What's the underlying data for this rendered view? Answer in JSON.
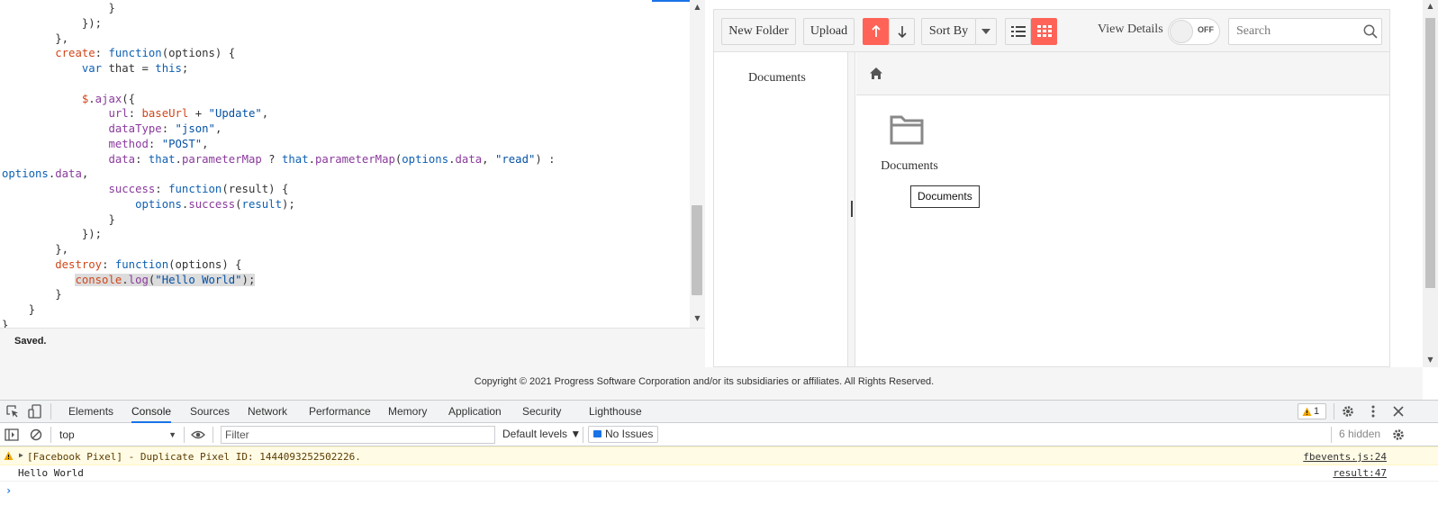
{
  "editor": {
    "lines": [
      [
        {
          "t": "                }",
          "c": "plain"
        }
      ],
      [
        {
          "t": "            });",
          "c": "plain"
        }
      ],
      [
        {
          "t": "        },",
          "c": "plain"
        }
      ],
      [
        {
          "t": "        ",
          "c": "plain"
        },
        {
          "t": "create",
          "c": "var"
        },
        {
          "t": ": ",
          "c": "plain"
        },
        {
          "t": "function",
          "c": "kw"
        },
        {
          "t": "(options) {",
          "c": "plain"
        }
      ],
      [
        {
          "t": "            ",
          "c": "plain"
        },
        {
          "t": "var",
          "c": "kw"
        },
        {
          "t": " that = ",
          "c": "plain"
        },
        {
          "t": "this",
          "c": "kw"
        },
        {
          "t": ";",
          "c": "plain"
        }
      ],
      [
        {
          "t": "",
          "c": "plain"
        }
      ],
      [
        {
          "t": "            ",
          "c": "plain"
        },
        {
          "t": "$",
          "c": "var"
        },
        {
          "t": ".",
          "c": "plain"
        },
        {
          "t": "ajax",
          "c": "prop"
        },
        {
          "t": "({",
          "c": "plain"
        }
      ],
      [
        {
          "t": "                ",
          "c": "plain"
        },
        {
          "t": "url",
          "c": "prop"
        },
        {
          "t": ": ",
          "c": "plain"
        },
        {
          "t": "baseUrl",
          "c": "var"
        },
        {
          "t": " + ",
          "c": "plain"
        },
        {
          "t": "\"Update\"",
          "c": "str"
        },
        {
          "t": ",",
          "c": "plain"
        }
      ],
      [
        {
          "t": "                ",
          "c": "plain"
        },
        {
          "t": "dataType",
          "c": "prop"
        },
        {
          "t": ": ",
          "c": "plain"
        },
        {
          "t": "\"json\"",
          "c": "str"
        },
        {
          "t": ",",
          "c": "plain"
        }
      ],
      [
        {
          "t": "                ",
          "c": "plain"
        },
        {
          "t": "method",
          "c": "prop"
        },
        {
          "t": ": ",
          "c": "plain"
        },
        {
          "t": "\"POST\"",
          "c": "str"
        },
        {
          "t": ",",
          "c": "plain"
        }
      ],
      [
        {
          "t": "                ",
          "c": "plain"
        },
        {
          "t": "data",
          "c": "prop"
        },
        {
          "t": ": ",
          "c": "plain"
        },
        {
          "t": "that",
          "c": "kw"
        },
        {
          "t": ".",
          "c": "plain"
        },
        {
          "t": "parameterMap",
          "c": "prop"
        },
        {
          "t": " ? ",
          "c": "plain"
        },
        {
          "t": "that",
          "c": "kw"
        },
        {
          "t": ".",
          "c": "plain"
        },
        {
          "t": "parameterMap",
          "c": "prop"
        },
        {
          "t": "(",
          "c": "plain"
        },
        {
          "t": "options",
          "c": "kw"
        },
        {
          "t": ".",
          "c": "plain"
        },
        {
          "t": "data",
          "c": "prop"
        },
        {
          "t": ", ",
          "c": "plain"
        },
        {
          "t": "\"read\"",
          "c": "str"
        },
        {
          "t": ") :",
          "c": "plain"
        }
      ],
      [
        {
          "t": "options",
          "c": "kw"
        },
        {
          "t": ".",
          "c": "plain"
        },
        {
          "t": "data",
          "c": "prop"
        },
        {
          "t": ",",
          "c": "plain"
        }
      ],
      [
        {
          "t": "                ",
          "c": "plain"
        },
        {
          "t": "success",
          "c": "prop"
        },
        {
          "t": ": ",
          "c": "plain"
        },
        {
          "t": "function",
          "c": "kw"
        },
        {
          "t": "(result) {",
          "c": "plain"
        }
      ],
      [
        {
          "t": "                    ",
          "c": "plain"
        },
        {
          "t": "options",
          "c": "kw"
        },
        {
          "t": ".",
          "c": "plain"
        },
        {
          "t": "success",
          "c": "prop"
        },
        {
          "t": "(",
          "c": "plain"
        },
        {
          "t": "result",
          "c": "kw"
        },
        {
          "t": ");",
          "c": "plain"
        }
      ],
      [
        {
          "t": "                }",
          "c": "plain"
        }
      ],
      [
        {
          "t": "            });",
          "c": "plain"
        }
      ],
      [
        {
          "t": "        },",
          "c": "plain"
        }
      ],
      [
        {
          "t": "        ",
          "c": "plain"
        },
        {
          "t": "destroy",
          "c": "var"
        },
        {
          "t": ": ",
          "c": "plain"
        },
        {
          "t": "function",
          "c": "kw"
        },
        {
          "t": "(options) {",
          "c": "plain"
        }
      ],
      [
        {
          "t": "           ",
          "c": "plain"
        },
        {
          "t": "console",
          "c": "var",
          "hl": true
        },
        {
          "t": ".",
          "c": "plain",
          "hl": true
        },
        {
          "t": "log",
          "c": "prop",
          "hl": true
        },
        {
          "t": "(",
          "c": "plain",
          "hl": true
        },
        {
          "t": "\"Hello World\"",
          "c": "str",
          "hl": true
        },
        {
          "t": ");",
          "c": "plain",
          "hl": true
        }
      ],
      [
        {
          "t": "        }",
          "c": "plain"
        }
      ],
      [
        {
          "t": "    }",
          "c": "plain"
        }
      ],
      [
        {
          "t": "}",
          "c": "plain"
        }
      ]
    ],
    "status": "Saved."
  },
  "filemanager": {
    "toolbar": {
      "new_folder": "New Folder",
      "upload": "Upload",
      "sort_by": "Sort By",
      "view_details": "View Details",
      "switch_state": "OFF",
      "search_placeholder": "Search"
    },
    "tree": {
      "root": "Documents"
    },
    "items": [
      {
        "name": "Documents",
        "type": "folder"
      }
    ],
    "tooltip": "Documents"
  },
  "footer": {
    "copyright": "Copyright © 2021 Progress Software Corporation and/or its subsidiaries or affiliates. All Rights Reserved."
  },
  "devtools": {
    "tabs": [
      "Elements",
      "Console",
      "Sources",
      "Network",
      "Performance",
      "Memory",
      "Application",
      "Security",
      "Lighthouse"
    ],
    "active_tab": "Console",
    "warning_count": "1",
    "toolbar": {
      "context": "top",
      "filter_placeholder": "Filter",
      "levels": "Default levels ▼",
      "no_issues": "No Issues",
      "hidden": "6 hidden"
    },
    "messages": [
      {
        "level": "warning",
        "text": "[Facebook Pixel] - Duplicate Pixel ID: 1444093252502226.",
        "source": "fbevents.js:24"
      },
      {
        "level": "log",
        "text": "Hello World",
        "source": "result:47"
      }
    ],
    "prompt": "›"
  },
  "colors": {
    "accent": "#ff6358",
    "devtools_blue": "#1a73e8",
    "warning_bg": "#fffbe5"
  }
}
